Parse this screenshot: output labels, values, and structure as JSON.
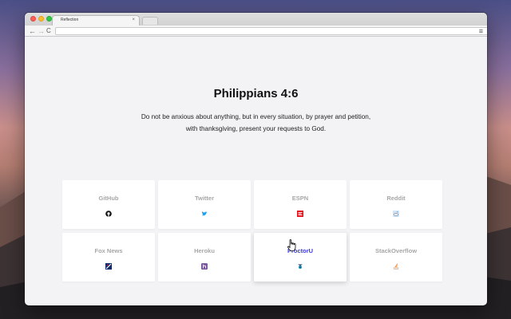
{
  "browser": {
    "tab_title": "Reflection",
    "tab_close": "×",
    "url": "",
    "nav": {
      "back": "←",
      "forward": "→",
      "reload": "C"
    },
    "star": "☆",
    "menu": "≡"
  },
  "verse": {
    "reference": "Philippians 4:6",
    "text_line1": "Do not be anxious about anything, but in every situation, by prayer and petition,",
    "text_line2": "with thanksgiving, present your requests to God."
  },
  "shortcuts": [
    {
      "label": "GitHub",
      "icon": "github-icon"
    },
    {
      "label": "Twitter",
      "icon": "twitter-icon"
    },
    {
      "label": "ESPN",
      "icon": "espn-icon"
    },
    {
      "label": "Reddit",
      "icon": "reddit-icon"
    },
    {
      "label": "Fox News",
      "icon": "foxnews-icon"
    },
    {
      "label": "Heroku",
      "icon": "heroku-icon"
    },
    {
      "label": "ProctorU",
      "icon": "proctoru-icon",
      "state": "hovered"
    },
    {
      "label": "StackOverflow",
      "icon": "stackoverflow-icon"
    }
  ],
  "colors": {
    "hover_label": "#3a3ad8",
    "tile_label": "#a7a7a7",
    "twitter": "#1da1f2",
    "espn": "#e4131e",
    "heroku": "#79589f",
    "stackoverflow": "#f48024"
  }
}
